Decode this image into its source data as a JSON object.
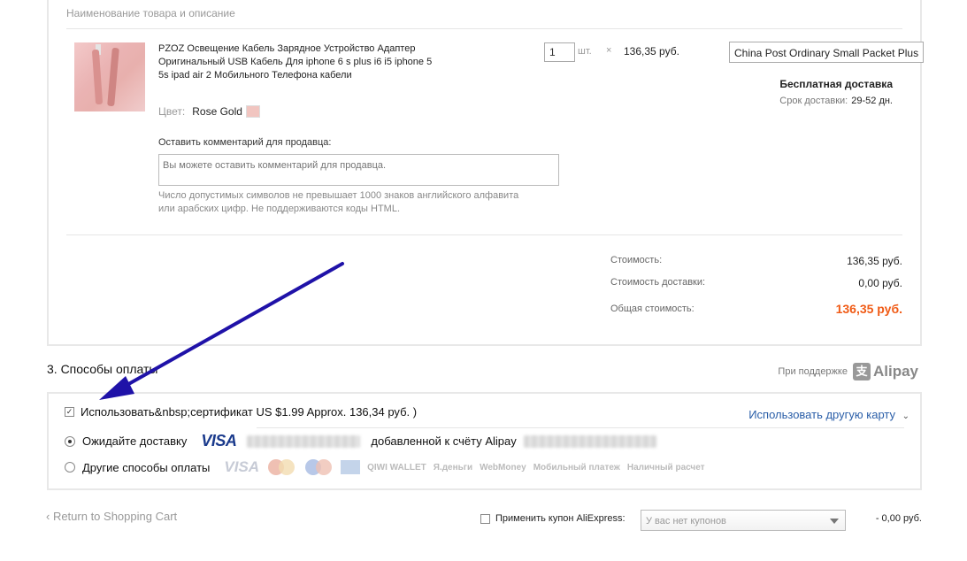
{
  "order": {
    "column_header": "Наименование товара и описание",
    "product": {
      "title": "PZOZ Освещение Кабель Зарядное Устройство Адаптер Оригинальный USB Кабель Для iphone 6 s plus i6 i5 iphone 5 5s ipad air 2 Мобильного Телефона кабели",
      "color_label": "Цвет:",
      "color_value": "Rose Gold",
      "quantity": "1",
      "unit": "шт.",
      "times": "×",
      "price": "136,35 руб."
    },
    "shipping": {
      "method": "China Post Ordinary Small Packet Plus",
      "free_label": "Бесплатная доставка",
      "time_label": "Срок доставки:",
      "time_value": "29-52 дн."
    },
    "comment": {
      "label": "Оставить комментарий для продавца:",
      "placeholder": "Вы можете оставить комментарий для продавца.",
      "hint": "Число допустимых символов не превышает 1000 знаков английского алфавита или арабских цифр. Не поддерживаются коды HTML."
    },
    "summary": {
      "cost_label": "Стоимость:",
      "cost_value": "136,35 руб.",
      "shipping_label": "Стоимость доставки:",
      "shipping_value": "0,00 руб.",
      "total_label": "Общая стоимость:",
      "total_value": "136,35 руб."
    }
  },
  "payment": {
    "section_title": "3. Способы оплаты",
    "powered_by": "При поддержке",
    "alipay": "Alipay",
    "certificate_option": "Использовать&nbsp;сертификат US $1.99 Approx. 136,34 руб. )",
    "other_card_link": "Использовать другую карту",
    "await_label": "Ожидайте доставку",
    "visa": "VISA",
    "added_label": "добавленной к счёту Alipay",
    "other_methods": "Другие способы оплаты",
    "logos": [
      "visa-icon",
      "mastercard-icon",
      "maestro-icon",
      "amex-icon",
      "qiwi-wallet-icon",
      "yandex-money-icon",
      "webmoney-icon",
      "mobile-payment-icon",
      "cash-payment-icon"
    ],
    "logo_texts": {
      "visa": "VISA",
      "qiwi": "QIWI WALLET",
      "yandex": "Я.деньги",
      "webmoney": "WebMoney",
      "mobile": "Мобильный платеж",
      "cash": "Наличный расчет"
    }
  },
  "footer": {
    "return_link": "‹ Return to Shopping Cart",
    "coupon_label": "Применить купон AliExpress:",
    "coupon_select": "У вас нет купонов",
    "coupon_amount": "- 0,00 руб."
  },
  "colors": {
    "total_price": "#f05b16",
    "link": "#2a5ea8",
    "arrow": "#1f12a8"
  }
}
